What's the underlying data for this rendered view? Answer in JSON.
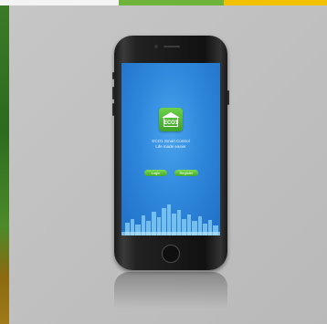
{
  "device": {
    "app_name": "ECO1",
    "tagline_line1": "ECO1 Smart Control",
    "tagline_line2": "Life made easier",
    "buttons": {
      "login": "Login",
      "register": "Register"
    }
  },
  "colors": {
    "screen_blue": "#2f88dc",
    "button_green": "#5cc33a",
    "logo_green": "#4fb02e",
    "backdrop_gray": "#bdbdbd"
  },
  "icons": [
    "eco1-house-logo-icon",
    "city-skyline-graphic"
  ]
}
